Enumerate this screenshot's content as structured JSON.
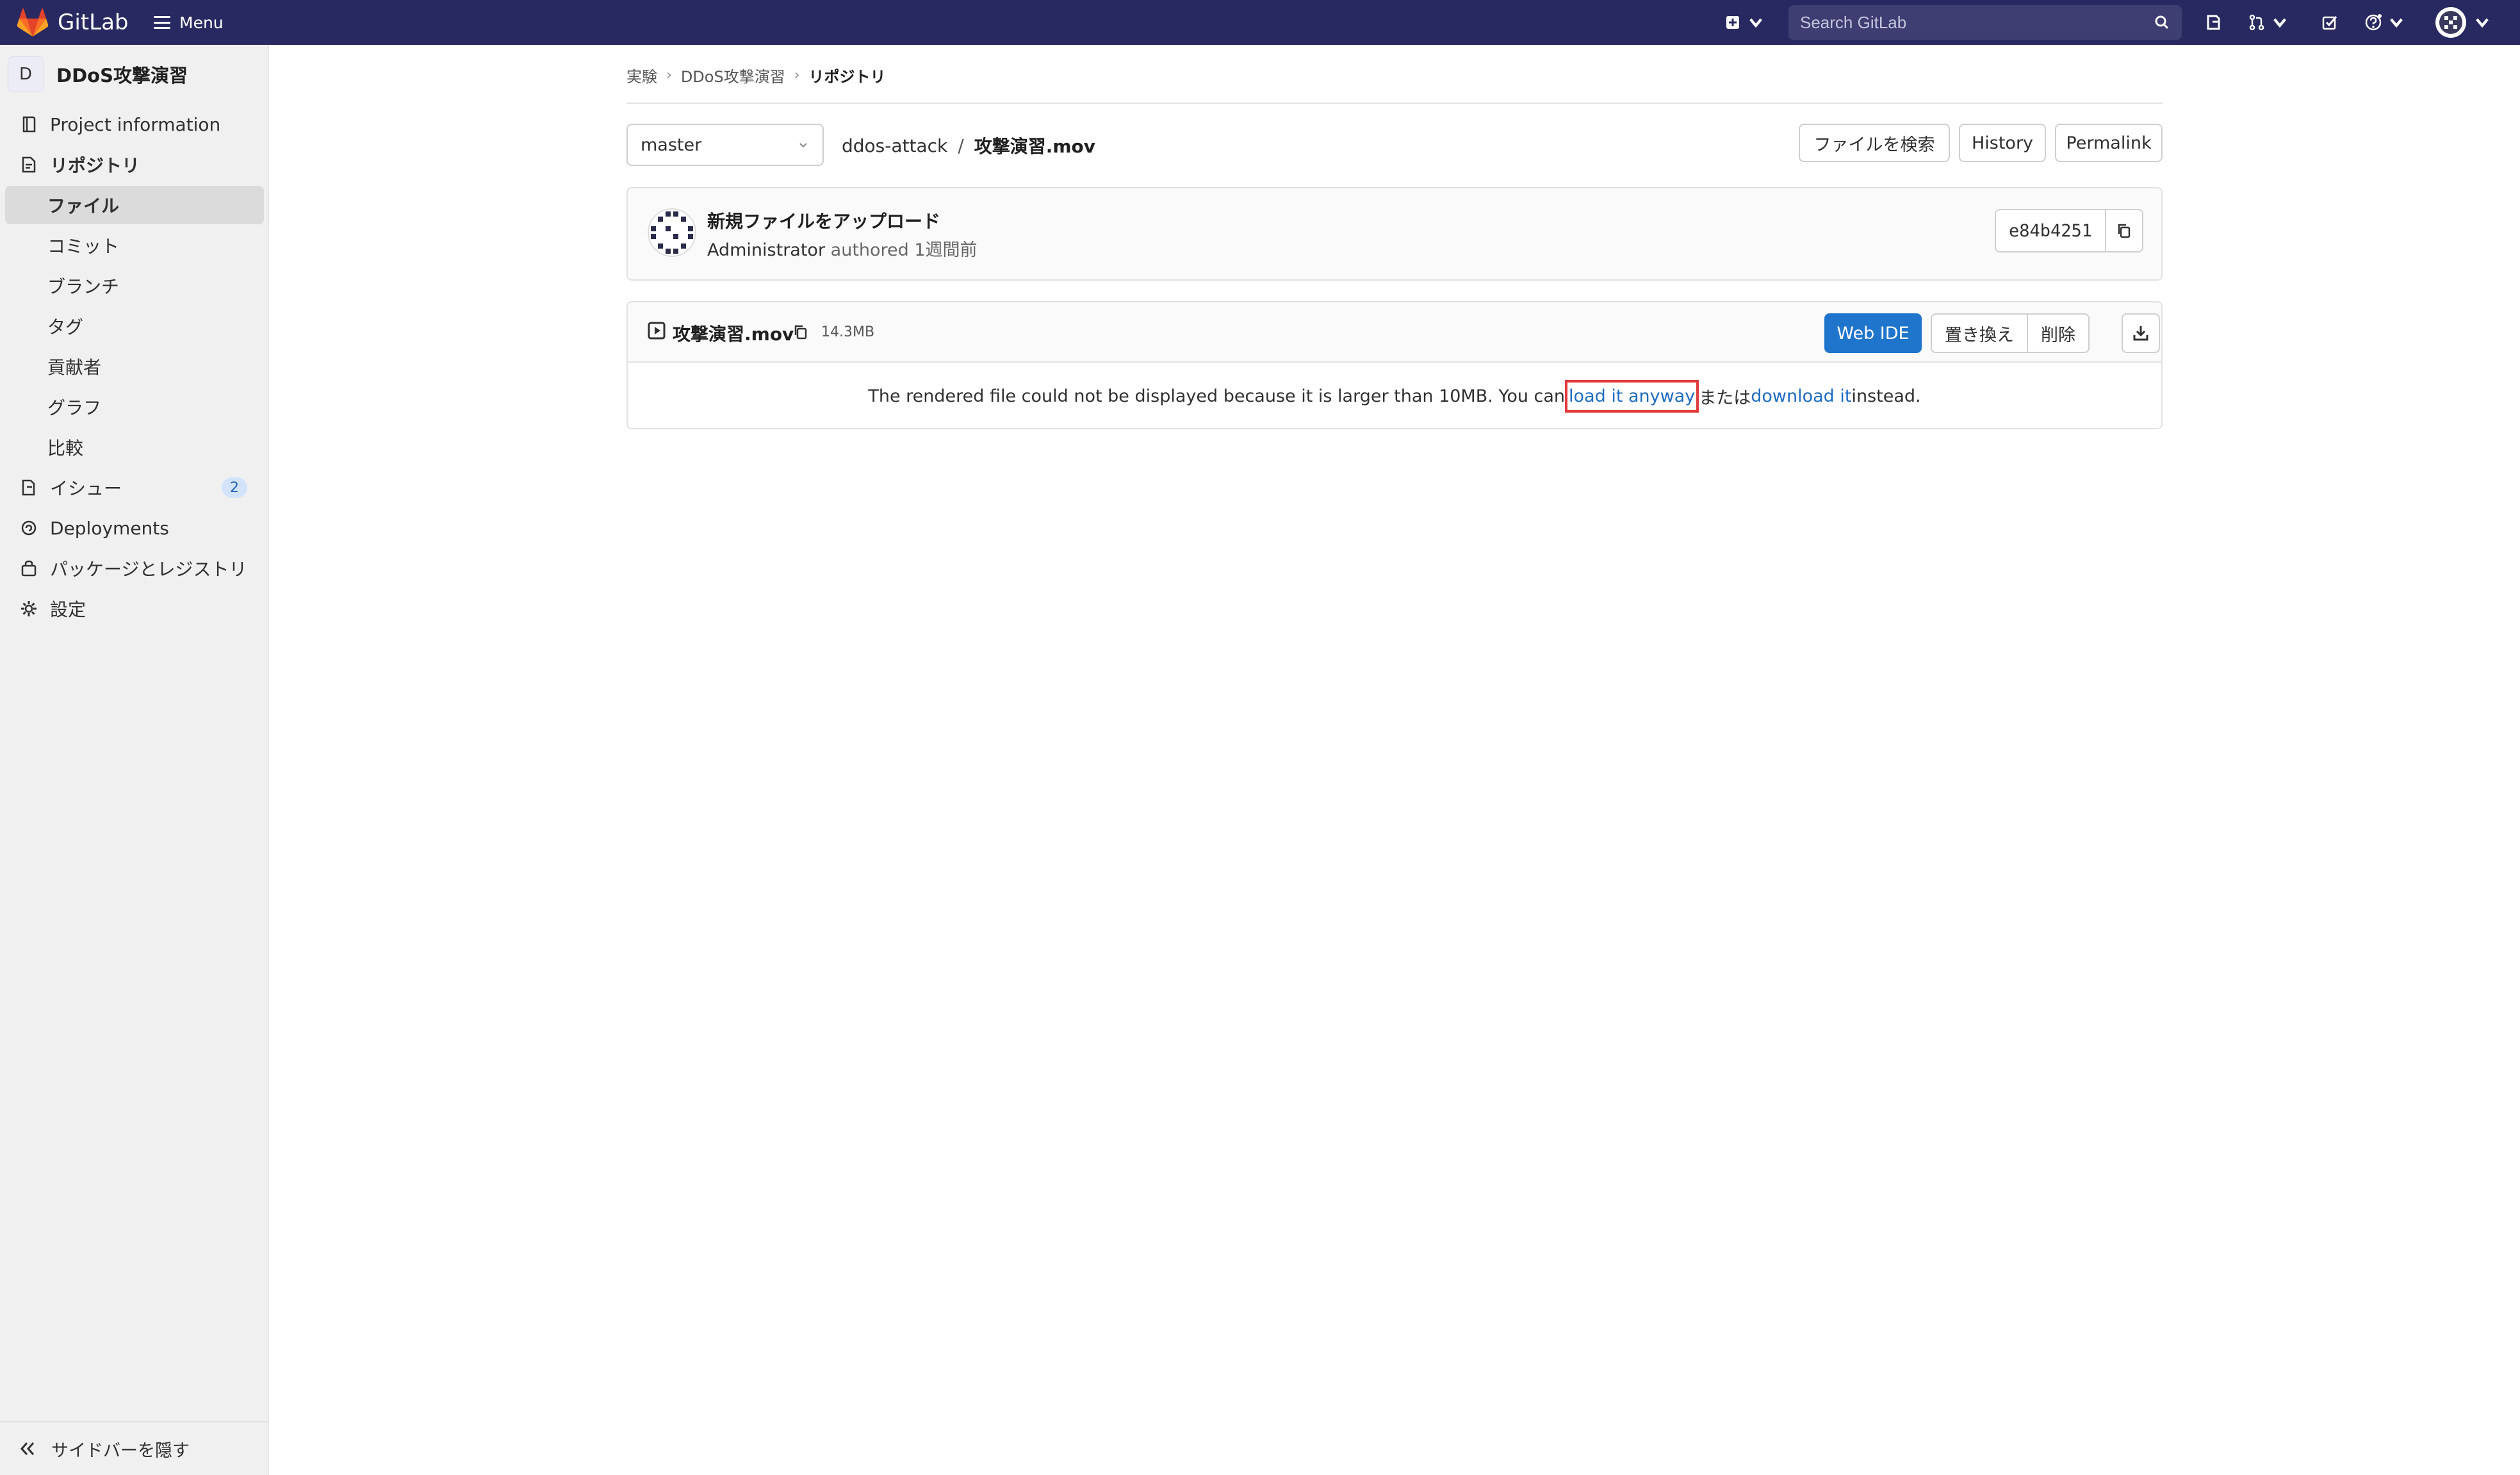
{
  "topbar": {
    "logo_text": "GitLab",
    "menu_label": "Menu",
    "search_placeholder": "Search GitLab"
  },
  "sidebar": {
    "project_initial": "D",
    "project_name": "DDoS攻撃演習",
    "items": [
      {
        "label": "Project information",
        "icon": "project-info-icon"
      },
      {
        "label": "リポジトリ",
        "icon": "repository-icon"
      },
      {
        "label": "ファイル"
      },
      {
        "label": "コミット"
      },
      {
        "label": "ブランチ"
      },
      {
        "label": "タグ"
      },
      {
        "label": "貢献者"
      },
      {
        "label": "グラフ"
      },
      {
        "label": "比較"
      },
      {
        "label": "イシュー",
        "icon": "issues-icon",
        "badge": "2"
      },
      {
        "label": "Deployments",
        "icon": "deployments-icon"
      },
      {
        "label": "パッケージとレジストリ",
        "icon": "package-icon"
      },
      {
        "label": "設定",
        "icon": "gear-icon"
      }
    ],
    "collapse_label": "サイドバーを隠す"
  },
  "breadcrumb": [
    "実験",
    "DDoS攻撃演習",
    "リポジトリ"
  ],
  "toolbar": {
    "branch": "master",
    "path_dir": "ddos-attack",
    "path_sep": "/",
    "path_file": "攻撃演習.mov",
    "find_file": "ファイルを検索",
    "history": "History",
    "permalink": "Permalink"
  },
  "commit": {
    "title": "新規ファイルをアップロード",
    "author": "Administrator",
    "authored": "authored 1週間前",
    "sha": "e84b4251"
  },
  "file": {
    "name": "攻撃演習.mov",
    "size": "14.3MB",
    "web_ide": "Web IDE",
    "replace": "置き換え",
    "delete": "削除",
    "msg_before": "The rendered file could not be displayed because it is larger than 10MB. You can ",
    "load_link": "load it anyway",
    "msg_mid": " または ",
    "download_link": "download it",
    "msg_after": " instead."
  },
  "colors": {
    "navbar": "#292961",
    "primary": "#1f75cb",
    "highlight": "#e03c3c"
  }
}
